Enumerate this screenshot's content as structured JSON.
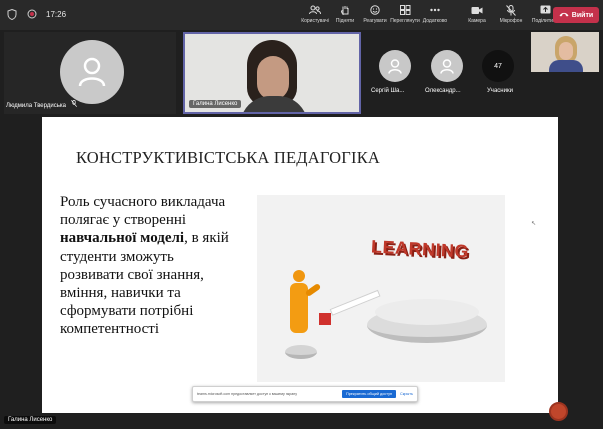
{
  "topbar": {
    "timer": "17:26",
    "actions": [
      {
        "label": "Користувачі",
        "icon": "people-icon"
      },
      {
        "label": "Підняти",
        "icon": "raise-hand-icon"
      },
      {
        "label": "Реагувати",
        "icon": "react-icon"
      },
      {
        "label": "Переглянути",
        "icon": "view-icon"
      },
      {
        "label": "Додатково",
        "icon": "more-icon"
      }
    ],
    "camera_label": "Камера",
    "mic_label": "Мікрофон",
    "share_label": "Поділитися",
    "leave_label": "Вийти",
    "colors": {
      "leave": "#c4314b",
      "accent": "#6264a7"
    }
  },
  "participants": {
    "main_tile_name": "Людмила Твердиська",
    "video_tile_name": "Галина Лисенко",
    "small": [
      {
        "name": "Сергій Ша..."
      },
      {
        "name": "Олександр..."
      }
    ],
    "others_count": "47",
    "others_label": "Учасники"
  },
  "slide": {
    "title": "КОНСТРУКТИВІСТСЬКА ПЕДАГОГІКА",
    "text_before": "Роль сучасного викладача полягає у створенні ",
    "text_bold": "навчальної моделі",
    "text_after": ", в якій студенти зможуть розвивати свої знання, вміння, навички та сформувати потрібні компетентності",
    "image_word": "LEARNING"
  },
  "share_banner": {
    "message": "teams.microsoft.com предоставляет доступ к вашему экрану",
    "allow_label": "Прекратить общий доступ",
    "hide_label": "Скрыть"
  },
  "presenter_name": "Галина Лисенко"
}
